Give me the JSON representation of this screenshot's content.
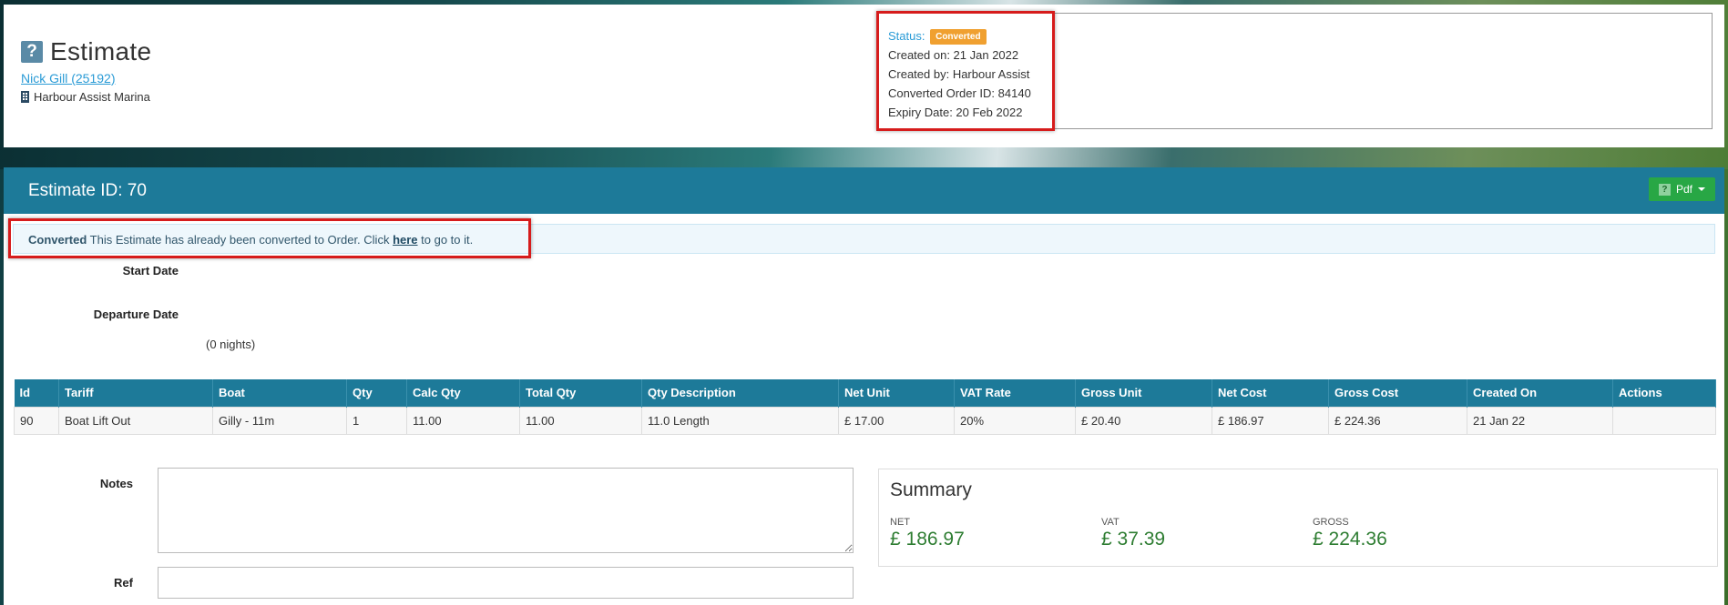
{
  "header": {
    "title": "Estimate",
    "title_icon": "question-icon",
    "customer_link": "Nick Gill (25192)",
    "marina": "Harbour Assist Marina"
  },
  "status_panel": {
    "status_label": "Status:",
    "status_badge": "Converted",
    "created_on": "Created on: 21 Jan 2022",
    "created_by": "Created by: Harbour Assist",
    "converted_order": "Converted Order ID: 84140",
    "expiry": "Expiry Date: 20 Feb 2022"
  },
  "main": {
    "estimate_id": "Estimate ID: 70",
    "pdf_label": "Pdf",
    "alert": {
      "strong": "Converted",
      "text_before": " This Estimate has already been converted to Order. Click ",
      "link": "here",
      "text_after": " to go to it."
    },
    "start_date_label": "Start Date",
    "departure_date_label": "Departure Date",
    "nights": "(0 nights)"
  },
  "table": {
    "headers": [
      "Id",
      "Tariff",
      "Boat",
      "Qty",
      "Calc Qty",
      "Total Qty",
      "Qty Description",
      "Net Unit",
      "VAT Rate",
      "Gross Unit",
      "Net Cost",
      "Gross Cost",
      "Created On",
      "Actions"
    ],
    "rows": [
      [
        "90",
        "Boat Lift Out",
        "Gilly - 11m",
        "1",
        "11.00",
        "11.00",
        "11.0 Length",
        "£ 17.00",
        "20%",
        "£ 20.40",
        "£ 186.97",
        "£ 224.36",
        "21 Jan 22",
        ""
      ]
    ]
  },
  "notes_label": "Notes",
  "ref_label": "Ref",
  "summary": {
    "title": "Summary",
    "net_label": "NET",
    "net_value": "£ 186.97",
    "vat_label": "VAT",
    "vat_value": "£ 37.39",
    "gross_label": "GROSS",
    "gross_value": "£ 224.36"
  },
  "colors": {
    "accent": "#1d7a99",
    "badge": "#f0a030",
    "pdf_button": "#28a745",
    "summary_values": "#2e7d32",
    "highlight_box": "#d61c1c"
  }
}
